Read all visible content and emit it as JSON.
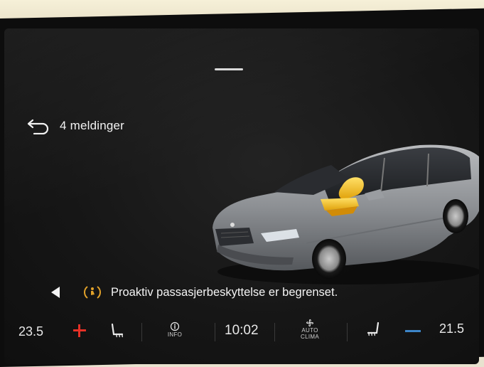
{
  "header": {
    "back_label": "4 meldinger"
  },
  "message": {
    "text": "Proaktiv passasjerbeskyttelse er begrenset."
  },
  "climate": {
    "left_temp": "23.5",
    "right_temp": "21.5",
    "info_label": "INFO",
    "auto_label": "AUTO",
    "clima_label": "CLIMA",
    "clock": "10:02"
  },
  "icons": {
    "back": "back-arrow-icon",
    "prev": "previous-arrow-icon",
    "warning": "passenger-protection-warning-icon",
    "seat_heat_left": "seat-heating-left-icon",
    "seat_heat_right": "seat-heating-right-icon",
    "info": "info-icon",
    "fan": "fan-icon",
    "plus": "plus-icon",
    "minus": "minus-icon"
  },
  "colors": {
    "warning": "#e2a22a",
    "plus": "#e53026",
    "minus": "#3d86c9",
    "car_highlight": "#f2c21a"
  }
}
